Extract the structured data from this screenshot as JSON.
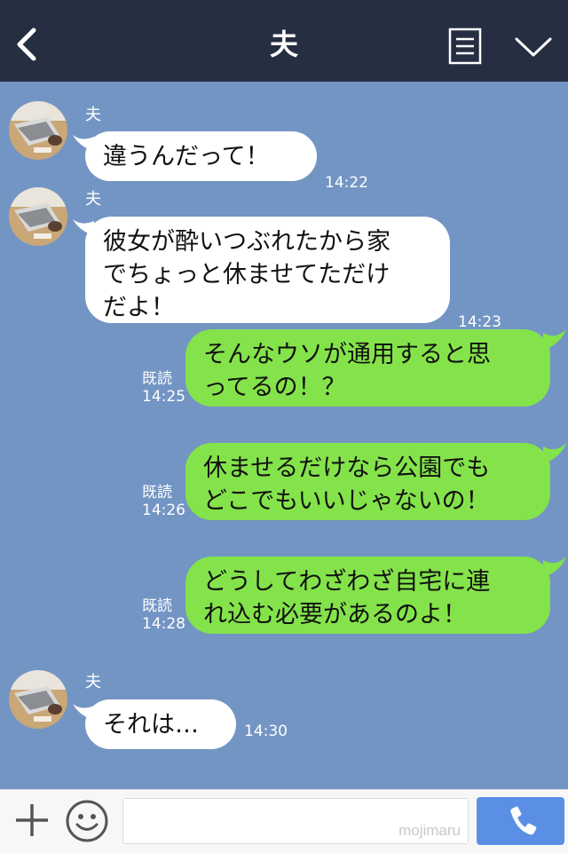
{
  "header": {
    "title": "夫",
    "back_icon": "chevron-left-icon",
    "menu_icon": "list-menu-icon",
    "collapse_icon": "chevron-down-icon"
  },
  "messages": [
    {
      "direction": "incoming",
      "sender": "夫",
      "text": "違うんだって！",
      "time": "14:22"
    },
    {
      "direction": "incoming",
      "sender": "夫",
      "text": "彼女が酔いつぶれたから家\nでちょっと休ませてただけ\nだよ！",
      "time": "14:23"
    },
    {
      "direction": "outgoing",
      "read": "既読",
      "text": "そんなウソが通用すると思\nってるの！？",
      "time": "14:25"
    },
    {
      "direction": "outgoing",
      "read": "既読",
      "text": "休ませるだけなら公園でも\nどこでもいいじゃないの！",
      "time": "14:26"
    },
    {
      "direction": "outgoing",
      "read": "既読",
      "text": "どうしてわざわざ自宅に連\nれ込む必要があるのよ！",
      "time": "14:28"
    },
    {
      "direction": "incoming",
      "sender": "夫",
      "text": "それは…",
      "time": "14:30"
    }
  ],
  "input_bar": {
    "plus_icon": "plus-icon",
    "emoji_icon": "smiley-icon",
    "placeholder": "",
    "watermark": "mojimaru",
    "call_icon": "phone-icon"
  },
  "colors": {
    "header_bg": "#262e42",
    "chat_bg": "#7395c4",
    "incoming_bubble": "#ffffff",
    "outgoing_bubble": "#84e34a",
    "call_button": "#5b8fe6"
  }
}
